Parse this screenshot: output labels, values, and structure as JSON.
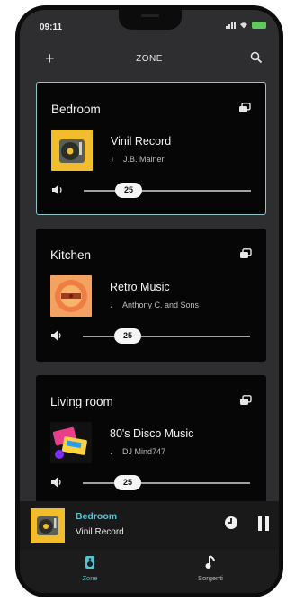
{
  "status_bar": {
    "time": "09:11"
  },
  "header": {
    "title": "ZONE",
    "add_label": "+"
  },
  "zones": [
    {
      "room": "Bedroom",
      "track": "Vinil Record",
      "artist": "J.B. Mainer",
      "volume": "25",
      "volume_level": 0.28,
      "art": "vinyl-record-art"
    },
    {
      "room": "Kitchen",
      "track": "Retro Music",
      "artist": "Anthony C. and Sons",
      "volume": "25",
      "volume_level": 0.28,
      "art": "retro-record-art"
    },
    {
      "room": "Living room",
      "track": "80's Disco Music",
      "artist": "DJ Mind747",
      "volume": "25",
      "volume_level": 0.28,
      "art": "cassette-art"
    }
  ],
  "now_playing": {
    "room": "Bedroom",
    "track": "Vinil Record"
  },
  "tabs": [
    {
      "label": "Zone",
      "active": true,
      "icon": "speaker-icon"
    },
    {
      "label": "Sorgenti",
      "active": false,
      "icon": "music-note-icon"
    }
  ],
  "colors": {
    "accent": "#57c3d0",
    "card_border": "#8fc3c9",
    "background": "#2e2e30",
    "card": "#060606",
    "art_yellow": "#f1bd2c",
    "art_orange": "#f28a4c"
  }
}
